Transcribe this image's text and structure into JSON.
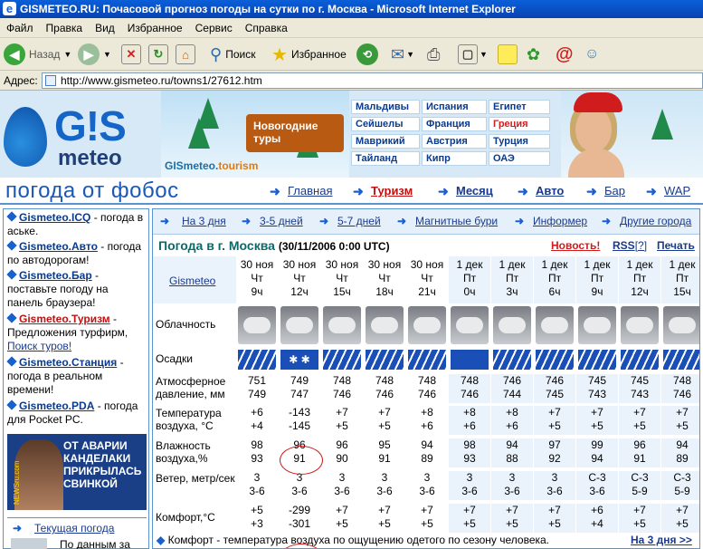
{
  "window": {
    "title": "GISMETEO.RU: Почасовой прогноз погоды на сутки по г. Москва - Microsoft Internet Explorer"
  },
  "menu": [
    "Файл",
    "Правка",
    "Вид",
    "Избранное",
    "Сервис",
    "Справка"
  ],
  "toolbar": {
    "back": "Назад",
    "search": "Поиск",
    "favorites": "Избранное"
  },
  "address": {
    "label": "Адрес:",
    "url": "http://www.gismeteo.ru/towns1/27612.htm"
  },
  "banner": {
    "logo_top": "G!S",
    "logo_bottom": "meteo",
    "sign": "Новогодние туры",
    "tourism": {
      "a": "GISmeteo.",
      "b": "tourism"
    },
    "destinations": [
      "Мальдивы",
      "Испания",
      "Египет",
      "Сейшелы",
      "Франция",
      "Греция",
      "Маврикий",
      "Австрия",
      "Турция",
      "Тайланд",
      "Кипр",
      "ОАЭ"
    ]
  },
  "site_title": "погода от фобос",
  "nav": [
    "Главная",
    "Туризм",
    "Месяц",
    "Авто",
    "Бар",
    "WAP"
  ],
  "sidebar": {
    "items": [
      {
        "name": "Gismeteo.ICQ",
        "text": " - погода в аське."
      },
      {
        "name": "Gismeteo.Авто",
        "text": " - погода по автодорогам!"
      },
      {
        "name": "Gismeteo.Бар",
        "text": " - поставьте погоду на панель браузера!"
      },
      {
        "name": "Gismeteo.Туризм",
        "text": " - Предложения турфирм, "
      },
      {
        "name": "Gismeteo.Станция",
        "text": " - погода в реальном времени!"
      },
      {
        "name": "Gismeteo.PDA",
        "text": " - погода для Pocket PC."
      }
    ],
    "tour_link": "Поиск туров!",
    "ad_text": "ОТ АВАРИИ КАНДЕЛАКИ ПРИКРЫЛАСЬ СВИНКОЙ",
    "ad_brand": "NEWSru.com",
    "current": "Текущая погода",
    "current_text": "По данным за"
  },
  "tabs": [
    "На 3 дня",
    "3-5 дней",
    "5-7 дней",
    "Магнитные бури",
    "Информер",
    "Другие города"
  ],
  "forecast": {
    "title": "Погода в г. Москва",
    "date": "(30/11/2006 0:00",
    "utc": " UTC)",
    "news": "Новость!",
    "rss": "RSS",
    "rss_q": "[?]",
    "print": "Печать",
    "source": "Gismeteo",
    "columns": [
      {
        "date": "30 ноя",
        "day": "Чт",
        "hour": "9ч"
      },
      {
        "date": "30 ноя",
        "day": "Чт",
        "hour": "12ч"
      },
      {
        "date": "30 ноя",
        "day": "Чт",
        "hour": "15ч"
      },
      {
        "date": "30 ноя",
        "day": "Чт",
        "hour": "18ч"
      },
      {
        "date": "30 ноя",
        "day": "Чт",
        "hour": "21ч"
      },
      {
        "date": "1 дек",
        "day": "Пт",
        "hour": "0ч"
      },
      {
        "date": "1 дек",
        "day": "Пт",
        "hour": "3ч"
      },
      {
        "date": "1 дек",
        "day": "Пт",
        "hour": "6ч"
      },
      {
        "date": "1 дек",
        "day": "Пт",
        "hour": "9ч"
      },
      {
        "date": "1 дек",
        "day": "Пт",
        "hour": "12ч"
      },
      {
        "date": "1 дек",
        "day": "Пт",
        "hour": "15ч"
      }
    ],
    "labels": {
      "clouds": "Облачность",
      "precip": "Осадки",
      "pressure": "Атмосферное давление, мм",
      "temp": "Температура воздуха, °С",
      "humidity": "Влажность воздуха,%",
      "wind": "Ветер, метр/сек",
      "comfort": "Комфорт,°С"
    },
    "pressure": [
      [
        "751",
        "749"
      ],
      [
        "749",
        "747"
      ],
      [
        "748",
        "746"
      ],
      [
        "748",
        "746"
      ],
      [
        "748",
        "746"
      ],
      [
        "748",
        "746"
      ],
      [
        "746",
        "744"
      ],
      [
        "746",
        "745"
      ],
      [
        "745",
        "743"
      ],
      [
        "745",
        "743"
      ],
      [
        "748",
        "746"
      ]
    ],
    "temp": [
      [
        "+6",
        "+4"
      ],
      [
        "-143",
        "-145"
      ],
      [
        "+7",
        "+5"
      ],
      [
        "+7",
        "+5"
      ],
      [
        "+8",
        "+6"
      ],
      [
        "+8",
        "+6"
      ],
      [
        "+8",
        "+6"
      ],
      [
        "+7",
        "+5"
      ],
      [
        "+7",
        "+5"
      ],
      [
        "+7",
        "+5"
      ],
      [
        "+7",
        "+5"
      ]
    ],
    "humidity": [
      [
        "98",
        "93"
      ],
      [
        "96",
        "91"
      ],
      [
        "96",
        "90"
      ],
      [
        "95",
        "91"
      ],
      [
        "94",
        "89"
      ],
      [
        "98",
        "93"
      ],
      [
        "94",
        "88"
      ],
      [
        "97",
        "92"
      ],
      [
        "99",
        "94"
      ],
      [
        "96",
        "91"
      ],
      [
        "94",
        "89"
      ]
    ],
    "wind": [
      [
        "3",
        "3-6"
      ],
      [
        "3",
        "3-6"
      ],
      [
        "3",
        "3-6"
      ],
      [
        "3",
        "3-6"
      ],
      [
        "3",
        "3-6"
      ],
      [
        "3",
        "3-6"
      ],
      [
        "3",
        "3-6"
      ],
      [
        "3",
        "3-6"
      ],
      [
        "С-3",
        "3-6"
      ],
      [
        "С-3",
        "5-9"
      ],
      [
        "С-3",
        "5-9"
      ]
    ],
    "comfort": [
      [
        "+5",
        "+3"
      ],
      [
        "-299",
        "-301"
      ],
      [
        "+7",
        "+5"
      ],
      [
        "+7",
        "+5"
      ],
      [
        "+7",
        "+5"
      ],
      [
        "+7",
        "+5"
      ],
      [
        "+7",
        "+5"
      ],
      [
        "+7",
        "+5"
      ],
      [
        "+6",
        "+4"
      ],
      [
        "+7",
        "+5"
      ],
      [
        "+7",
        "+5"
      ]
    ],
    "precip_type": [
      "rain",
      "snow",
      "rain",
      "rain",
      "rain",
      "none",
      "rain",
      "rain",
      "rain",
      "rain",
      "rain"
    ],
    "note": "Комфорт - температура воздуха по ощущению одетого по сезону человека.",
    "next": "На 3 дня >>"
  }
}
